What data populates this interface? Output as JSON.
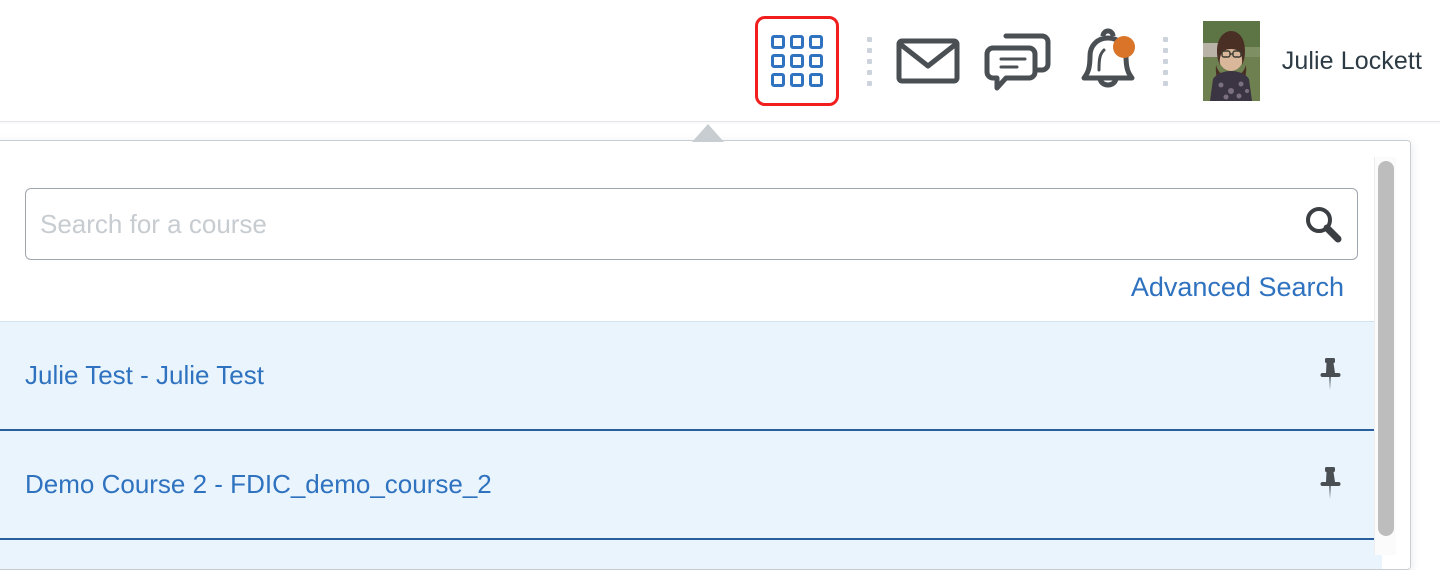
{
  "header": {
    "apps_button": {
      "name": "Course selector waffle",
      "icon": "waffle-grid-icon",
      "focus_color": "#f21d1d",
      "cell_color": "#2f72bf"
    },
    "mail_button": {
      "label": "Mail",
      "icon": "envelope-icon"
    },
    "chat_button": {
      "label": "Chat",
      "icon": "speech-bubbles-icon"
    },
    "alerts_button": {
      "label": "Alerts",
      "icon": "bell-icon",
      "badge": true,
      "badge_color": "#d97429"
    },
    "user": {
      "name": "Julie Lockett",
      "avatar_alt": "Julie Lockett profile photo"
    },
    "separator_dots": 5
  },
  "panel": {
    "search": {
      "value": "",
      "placeholder": "Search for a course",
      "icon": "search-icon"
    },
    "advanced_search_label": "Advanced Search",
    "courses": [
      {
        "label": "Julie Test - Julie Test",
        "pin_icon": "pushpin-icon",
        "pinned": true
      },
      {
        "label": "Demo Course 2 - FDIC_demo_course_2",
        "pin_icon": "pushpin-icon",
        "pinned": true
      },
      {
        "label": "",
        "pin_icon": "pushpin-icon",
        "pinned": true
      }
    ],
    "colors": {
      "row_background": "#e9f4fd",
      "row_divider": "#2a5f9e",
      "link": "#2f72bf"
    },
    "scrollbar": {
      "orientation": "vertical",
      "thumb_color": "#bdbdbd"
    }
  }
}
